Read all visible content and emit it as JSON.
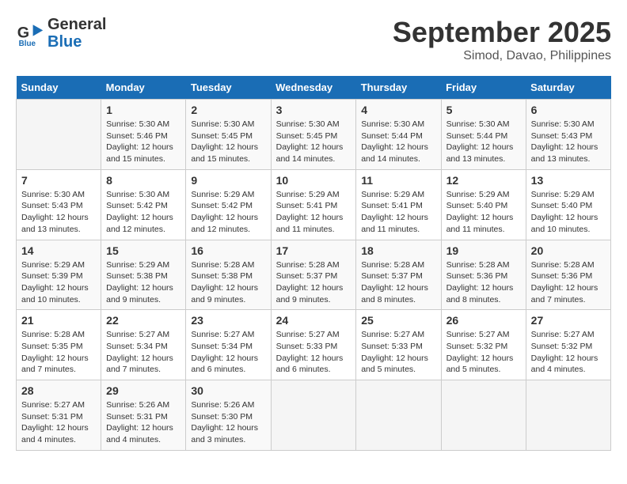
{
  "header": {
    "logo_line1": "General",
    "logo_line2": "Blue",
    "month": "September 2025",
    "location": "Simod, Davao, Philippines"
  },
  "days_of_week": [
    "Sunday",
    "Monday",
    "Tuesday",
    "Wednesday",
    "Thursday",
    "Friday",
    "Saturday"
  ],
  "weeks": [
    [
      {
        "day": "",
        "empty": true
      },
      {
        "day": "1",
        "sunrise": "5:30 AM",
        "sunset": "5:46 PM",
        "daylight": "12 hours and 15 minutes."
      },
      {
        "day": "2",
        "sunrise": "5:30 AM",
        "sunset": "5:45 PM",
        "daylight": "12 hours and 15 minutes."
      },
      {
        "day": "3",
        "sunrise": "5:30 AM",
        "sunset": "5:45 PM",
        "daylight": "12 hours and 14 minutes."
      },
      {
        "day": "4",
        "sunrise": "5:30 AM",
        "sunset": "5:44 PM",
        "daylight": "12 hours and 14 minutes."
      },
      {
        "day": "5",
        "sunrise": "5:30 AM",
        "sunset": "5:44 PM",
        "daylight": "12 hours and 13 minutes."
      },
      {
        "day": "6",
        "sunrise": "5:30 AM",
        "sunset": "5:43 PM",
        "daylight": "12 hours and 13 minutes."
      }
    ],
    [
      {
        "day": "7",
        "sunrise": "5:30 AM",
        "sunset": "5:43 PM",
        "daylight": "12 hours and 13 minutes."
      },
      {
        "day": "8",
        "sunrise": "5:30 AM",
        "sunset": "5:42 PM",
        "daylight": "12 hours and 12 minutes."
      },
      {
        "day": "9",
        "sunrise": "5:29 AM",
        "sunset": "5:42 PM",
        "daylight": "12 hours and 12 minutes."
      },
      {
        "day": "10",
        "sunrise": "5:29 AM",
        "sunset": "5:41 PM",
        "daylight": "12 hours and 11 minutes."
      },
      {
        "day": "11",
        "sunrise": "5:29 AM",
        "sunset": "5:41 PM",
        "daylight": "12 hours and 11 minutes."
      },
      {
        "day": "12",
        "sunrise": "5:29 AM",
        "sunset": "5:40 PM",
        "daylight": "12 hours and 11 minutes."
      },
      {
        "day": "13",
        "sunrise": "5:29 AM",
        "sunset": "5:40 PM",
        "daylight": "12 hours and 10 minutes."
      }
    ],
    [
      {
        "day": "14",
        "sunrise": "5:29 AM",
        "sunset": "5:39 PM",
        "daylight": "12 hours and 10 minutes."
      },
      {
        "day": "15",
        "sunrise": "5:29 AM",
        "sunset": "5:38 PM",
        "daylight": "12 hours and 9 minutes."
      },
      {
        "day": "16",
        "sunrise": "5:28 AM",
        "sunset": "5:38 PM",
        "daylight": "12 hours and 9 minutes."
      },
      {
        "day": "17",
        "sunrise": "5:28 AM",
        "sunset": "5:37 PM",
        "daylight": "12 hours and 9 minutes."
      },
      {
        "day": "18",
        "sunrise": "5:28 AM",
        "sunset": "5:37 PM",
        "daylight": "12 hours and 8 minutes."
      },
      {
        "day": "19",
        "sunrise": "5:28 AM",
        "sunset": "5:36 PM",
        "daylight": "12 hours and 8 minutes."
      },
      {
        "day": "20",
        "sunrise": "5:28 AM",
        "sunset": "5:36 PM",
        "daylight": "12 hours and 7 minutes."
      }
    ],
    [
      {
        "day": "21",
        "sunrise": "5:28 AM",
        "sunset": "5:35 PM",
        "daylight": "12 hours and 7 minutes."
      },
      {
        "day": "22",
        "sunrise": "5:27 AM",
        "sunset": "5:34 PM",
        "daylight": "12 hours and 7 minutes."
      },
      {
        "day": "23",
        "sunrise": "5:27 AM",
        "sunset": "5:34 PM",
        "daylight": "12 hours and 6 minutes."
      },
      {
        "day": "24",
        "sunrise": "5:27 AM",
        "sunset": "5:33 PM",
        "daylight": "12 hours and 6 minutes."
      },
      {
        "day": "25",
        "sunrise": "5:27 AM",
        "sunset": "5:33 PM",
        "daylight": "12 hours and 5 minutes."
      },
      {
        "day": "26",
        "sunrise": "5:27 AM",
        "sunset": "5:32 PM",
        "daylight": "12 hours and 5 minutes."
      },
      {
        "day": "27",
        "sunrise": "5:27 AM",
        "sunset": "5:32 PM",
        "daylight": "12 hours and 4 minutes."
      }
    ],
    [
      {
        "day": "28",
        "sunrise": "5:27 AM",
        "sunset": "5:31 PM",
        "daylight": "12 hours and 4 minutes."
      },
      {
        "day": "29",
        "sunrise": "5:26 AM",
        "sunset": "5:31 PM",
        "daylight": "12 hours and 4 minutes."
      },
      {
        "day": "30",
        "sunrise": "5:26 AM",
        "sunset": "5:30 PM",
        "daylight": "12 hours and 3 minutes."
      },
      {
        "day": "",
        "empty": true
      },
      {
        "day": "",
        "empty": true
      },
      {
        "day": "",
        "empty": true
      },
      {
        "day": "",
        "empty": true
      }
    ]
  ]
}
